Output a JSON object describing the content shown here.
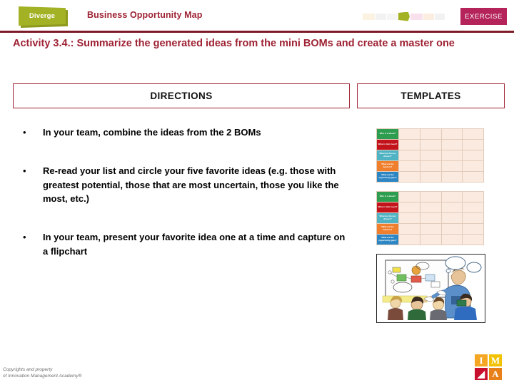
{
  "header": {
    "stage_badge": "Diverge",
    "title": "Business Opportunity Map",
    "type_badge": "EXERCISE",
    "process_graphic": {
      "name": "process-steps-graphic",
      "segments": [
        {
          "color": "#F7E7C8",
          "width": 18,
          "active": false
        },
        {
          "color": "#E8E8E8",
          "width": 16,
          "active": false
        },
        {
          "color": "#EDEDED",
          "width": 16,
          "active": false
        },
        {
          "color": "#A3B224",
          "width": 17,
          "active": true
        },
        {
          "color": "#F2C6DC",
          "width": 18,
          "active": false
        },
        {
          "color": "#F7DFC4",
          "width": 16,
          "active": false
        },
        {
          "color": "#E8E8E8",
          "width": 15,
          "active": false
        }
      ]
    }
  },
  "slide": {
    "title": "Activity 3.4.: Summarize the generated ideas from the mini BOMs and create a master one"
  },
  "sections": {
    "directions_label": "DIRECTIONS",
    "templates_label": "TEMPLATES"
  },
  "directions": {
    "bullet_marker": "•",
    "items": [
      "In your team, combine the ideas from the 2 BOMs",
      "Re-read your list and circle your five favorite ideas (e.g. those with greatest potential, those that are most uncertain, those you like the most, etc.)",
      "In your team, present your favorite idea one at a time and capture on a flipchart"
    ]
  },
  "templates": {
    "thumbnails": [
      {
        "name": "bom-template-thumbnail-1",
        "type": "table"
      },
      {
        "name": "bom-template-thumbnail-2",
        "type": "table"
      },
      {
        "name": "flipchart-illustration-thumbnail",
        "type": "illustration"
      }
    ],
    "bom_table": {
      "row_headers": [
        {
          "label": "Who is it about?",
          "color": "#2E9D4F"
        },
        {
          "label": "What is their need?",
          "color": "#C3141B"
        },
        {
          "label": "What are the key drivers?",
          "color": "#4FB3C4"
        },
        {
          "label": "What are the barriers?",
          "color": "#F07F2D"
        },
        {
          "label": "What are the opportunity gaps?",
          "color": "#2D86C4"
        }
      ],
      "background": "#FBEADF"
    }
  },
  "footer": {
    "copyright_line_1": "Copyrights and property",
    "copyright_line_2": "of Innovation Management Academy®",
    "logo": {
      "name": "ima-logo",
      "cells": [
        {
          "letter": "I",
          "bg": "#F5A623"
        },
        {
          "letter": "M",
          "bg": "#F2C200"
        },
        {
          "letter": "◢",
          "bg": "#C8102E"
        },
        {
          "letter": "A",
          "bg": "#E8801A"
        }
      ]
    }
  },
  "colors": {
    "brand_red": "#9E2233",
    "rule_red": "#7E1B28",
    "exercise_magenta": "#B4245A",
    "diverge_olive": "#A3B224"
  }
}
